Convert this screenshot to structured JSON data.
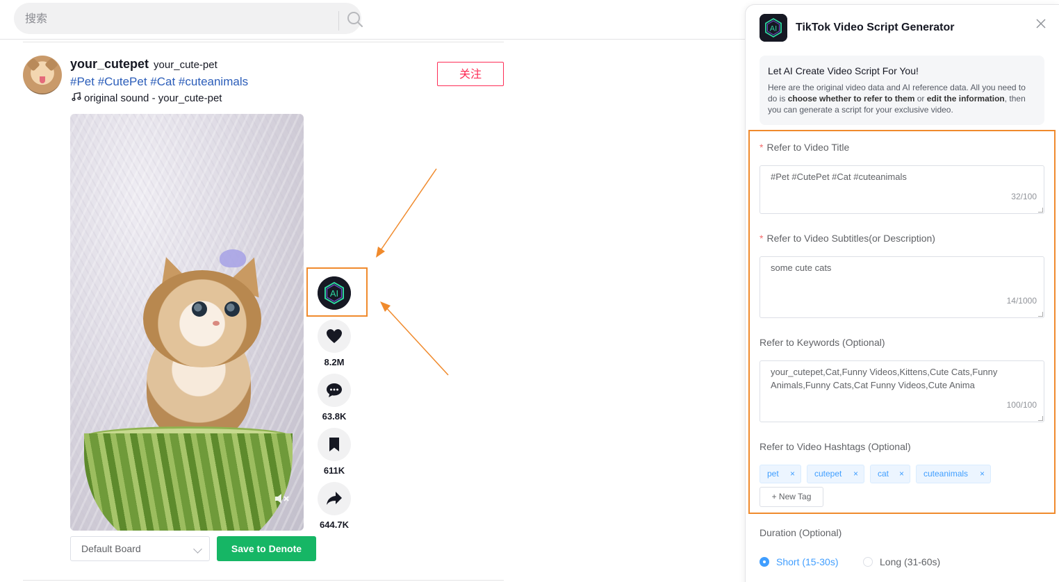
{
  "search": {
    "placeholder": "搜索"
  },
  "post": {
    "author": "your_cutepet",
    "handle": "your_cute-pet",
    "hashtags": "#Pet #CutePet #Cat #cuteanimals",
    "sound": "original sound - your_cute-pet",
    "follow_label": "关注"
  },
  "actions": {
    "ai_label": "AI",
    "likes": "8.2M",
    "comments": "63.8K",
    "saves": "611K",
    "shares": "644.7K"
  },
  "bottom": {
    "board_value": "Default Board",
    "save_label": "Save to Denote"
  },
  "panel": {
    "title": "TikTok Video Script Generator",
    "logo_text": "AI",
    "intro_title": "Let AI Create Video Script For You!",
    "intro_pre": "Here are the original video data and AI reference data. All you need to do is ",
    "intro_bold1": "choose whether to refer to them",
    "intro_mid": " or ",
    "intro_bold2": "edit the information",
    "intro_post": ", then you can generate a script for your exclusive video.",
    "fields": {
      "title_label": "Refer to Video Title",
      "title_value": "#Pet #CutePet #Cat #cuteanimals",
      "title_count": "32/100",
      "subtitle_label": "Refer to Video Subtitles(or Description)",
      "subtitle_value": "some cute cats",
      "subtitle_count": "14/1000",
      "keywords_label": "Refer to Keywords (Optional)",
      "keywords_value": "your_cutepet,Cat,Funny Videos,Kittens,Cute Cats,Funny Animals,Funny Cats,Cat Funny Videos,Cute Anima",
      "keywords_count": "100/100",
      "hashtags_label": "Refer to Video Hashtags (Optional)",
      "tags": [
        "pet",
        "cutepet",
        "cat",
        "cuteanimals"
      ],
      "new_tag_label": "+ New Tag",
      "duration_label": "Duration (Optional)",
      "duration_short": "Short (15-30s)",
      "duration_long": "Long (31-60s)",
      "duration_selected": "Short (15-30s)"
    }
  },
  "colors": {
    "accent": "#f08a2c",
    "follow": "#fe2c55",
    "save": "#16b665",
    "link": "#409eff",
    "hashtag": "#2b5db9"
  }
}
